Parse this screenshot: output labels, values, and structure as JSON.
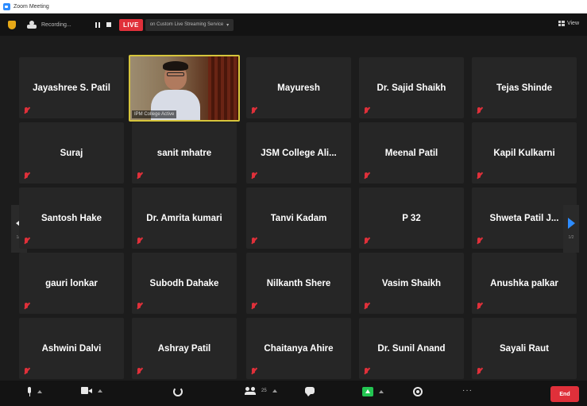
{
  "window": {
    "title": "Zoom Meeting"
  },
  "status_bar": {
    "recording_label": "Recording...",
    "live_label": "LIVE",
    "stream_label": "on Custom Live Streaming Service",
    "view_label": "View",
    "live_color": "#e0303a"
  },
  "video_tile": {
    "label": "IPM College Active",
    "highlight_color": "#d6c53c"
  },
  "participants": [
    [
      "Jayashree S. Patil",
      null,
      "Mayuresh",
      "Dr. Sajid Shaikh",
      "Tejas Shinde"
    ],
    [
      "Suraj",
      "sanit mhatre",
      "JSM College Ali...",
      "Meenal Patil",
      "Kapil Kulkarni"
    ],
    [
      "Santosh Hake",
      "Dr. Amrita kumari",
      "Tanvi Kadam",
      "P 32",
      "Shweta Patil J..."
    ],
    [
      "gauri lonkar",
      "Subodh Dahake",
      "Nilkanth Shere",
      "Vasim Shaikh",
      "Anushka palkar"
    ],
    [
      "Ashwini Dalvi",
      "Ashray Patil",
      "Chaitanya Ahire",
      "Dr. Sunil Anand",
      "Sayali Raut"
    ]
  ],
  "pagination": {
    "left_page": "1/2",
    "right_page": "1/2"
  },
  "toolbar": {
    "participant_count": "25",
    "end_label": "End",
    "end_color": "#e0303a",
    "share_color": "#23c552",
    "more_label": "···",
    "icons": [
      "mic-icon",
      "camera-icon",
      "security-icon",
      "participants-icon",
      "chat-icon",
      "share-screen-icon",
      "record-icon",
      "more-icon"
    ]
  }
}
